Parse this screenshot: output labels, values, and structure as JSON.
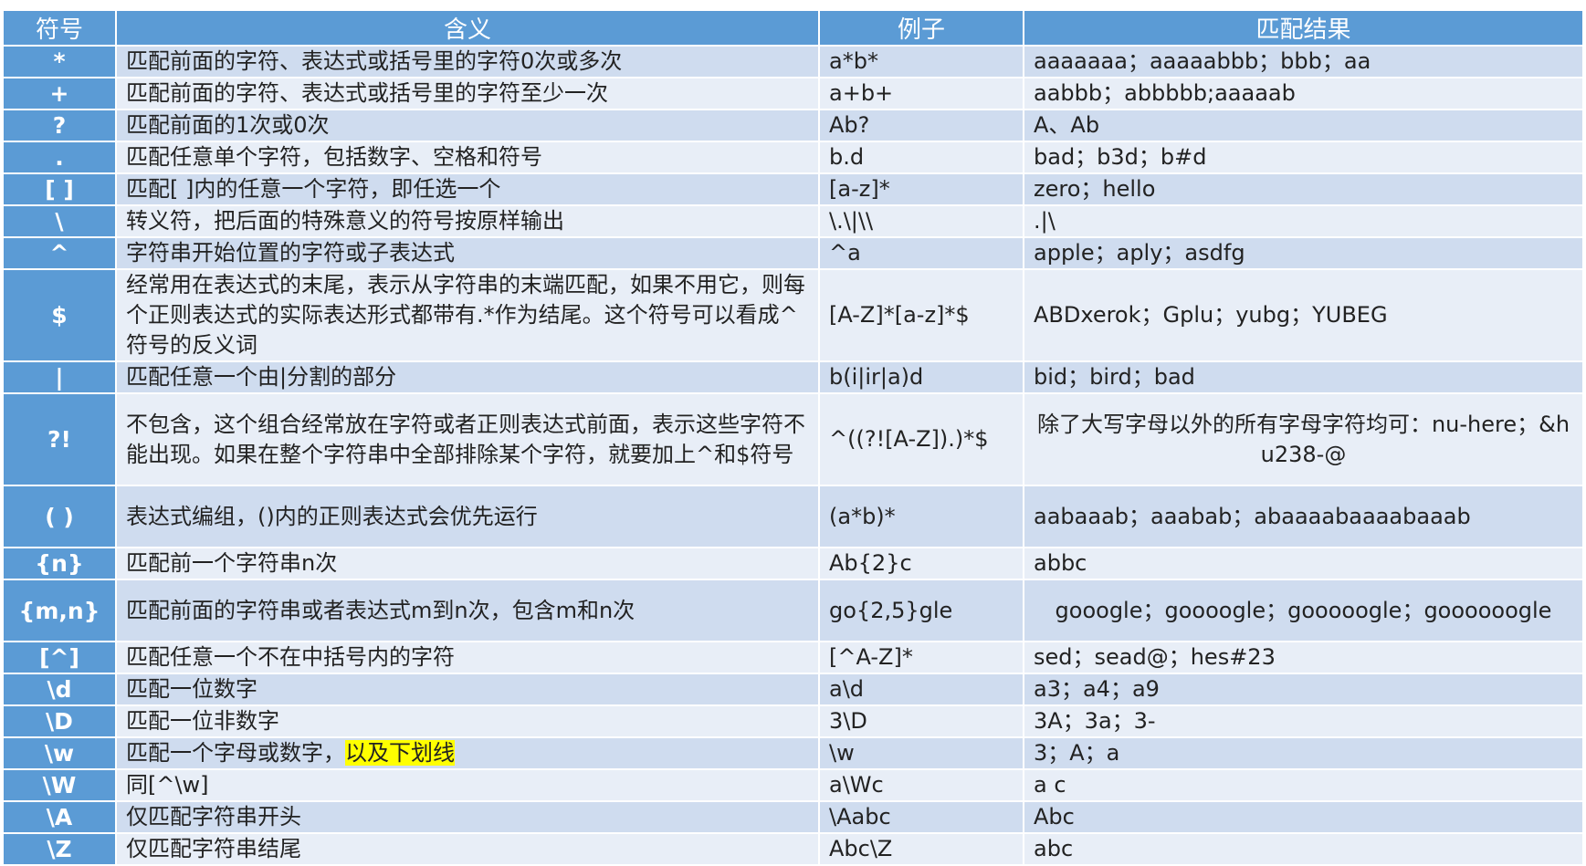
{
  "headers": {
    "symbol": "符号",
    "meaning": "含义",
    "example": "例子",
    "result": "匹配结果"
  },
  "rows": [
    {
      "symbol": "*",
      "meaning": "匹配前面的字符、表达式或括号里的字符0次或多次",
      "example": "a*b*",
      "result": "aaaaaaa；aaaaabbb；bbb；aa"
    },
    {
      "symbol": "+",
      "meaning": "匹配前面的字符、表达式或括号里的字符至少一次",
      "example": "a+b+",
      "result": "aabbb；abbbbb;aaaaab"
    },
    {
      "symbol": "?",
      "meaning": "匹配前面的1次或0次",
      "example": "Ab?",
      "result": "A、Ab"
    },
    {
      "symbol": ".",
      "meaning": "匹配任意单个字符，包括数字、空格和符号",
      "example": "b.d",
      "result": "bad；b3d；b#d"
    },
    {
      "symbol": "[ ]",
      "meaning": "匹配[ ]内的任意一个字符，即任选一个",
      "example": "[a-z]*",
      "result": "zero；hello"
    },
    {
      "symbol": "\\",
      "meaning": "转义符，把后面的特殊意义的符号按原样输出",
      "example": "\\.\\|\\\\",
      "result": ".|\\"
    },
    {
      "symbol": "^",
      "meaning": "字符串开始位置的字符或子表达式",
      "example": "^a",
      "result": "apple；aply；asdfg"
    },
    {
      "symbol": "$",
      "meaning": "经常用在表达式的末尾，表示从字符串的末端匹配，如果不用它，则每个正则表达式的实际表达形式都带有.*作为结尾。这个符号可以看成^符号的反义词",
      "example": "[A-Z]*[a-z]*$",
      "result": "ABDxerok；Gplu；yubg；YUBEG"
    },
    {
      "symbol": "|",
      "meaning": "匹配任意一个由|分割的部分",
      "example": "b(i|ir|a)d",
      "result": "bid；bird；bad"
    },
    {
      "symbol": "?!",
      "meaning": "不包含，这个组合经常放在字符或者正则表达式前面，表示这些字符不能出现。如果在整个字符串中全部排除某个字符，就要加上^和$符号",
      "example": "^((?![A-Z]).)*$",
      "result": "除了大写字母以外的所有字母字符均可：nu-here；&hu238-@"
    },
    {
      "symbol": "( )",
      "meaning": "表达式编组，()内的正则表达式会优先运行",
      "example": "(a*b)*",
      "result": "aabaaab；aaabab；abaaaabaaaabaaab"
    },
    {
      "symbol": "{n}",
      "meaning": "匹配前一个字符串n次",
      "example": "Ab{2}c",
      "result": "abbc"
    },
    {
      "symbol": "{m,n}",
      "meaning": "匹配前面的字符串或者表达式m到n次，包含m和n次",
      "example": "go{2,5}gle",
      "result": "gooogle；goooogle；gooooogle；goooooogle"
    },
    {
      "symbol": "[^]",
      "meaning": "匹配任意一个不在中括号内的字符",
      "example": "[^A-Z]*",
      "result": "sed；sead@；hes#23"
    },
    {
      "symbol": "\\d",
      "meaning": "匹配一位数字",
      "example": "a\\d",
      "result": "a3；a4；a9"
    },
    {
      "symbol": "\\D",
      "meaning": "匹配一位非数字",
      "example": "3\\D",
      "result": "3A；3a；3-"
    },
    {
      "symbol": "\\w",
      "meaning": "匹配一个字母或数字，",
      "meaning_highlight": "以及下划线",
      "example": "\\w",
      "result": "3；A；a"
    },
    {
      "symbol": "\\W",
      "meaning": "同[^\\w]",
      "example": "a\\Wc",
      "result": "a c"
    },
    {
      "symbol": "\\A",
      "meaning": "仅匹配字符串开头",
      "example": "\\Aabc",
      "result": "Abc"
    },
    {
      "symbol": "\\Z",
      "meaning": "仅匹配字符串结尾",
      "example": "Abc\\Z",
      "result": "abc"
    }
  ]
}
